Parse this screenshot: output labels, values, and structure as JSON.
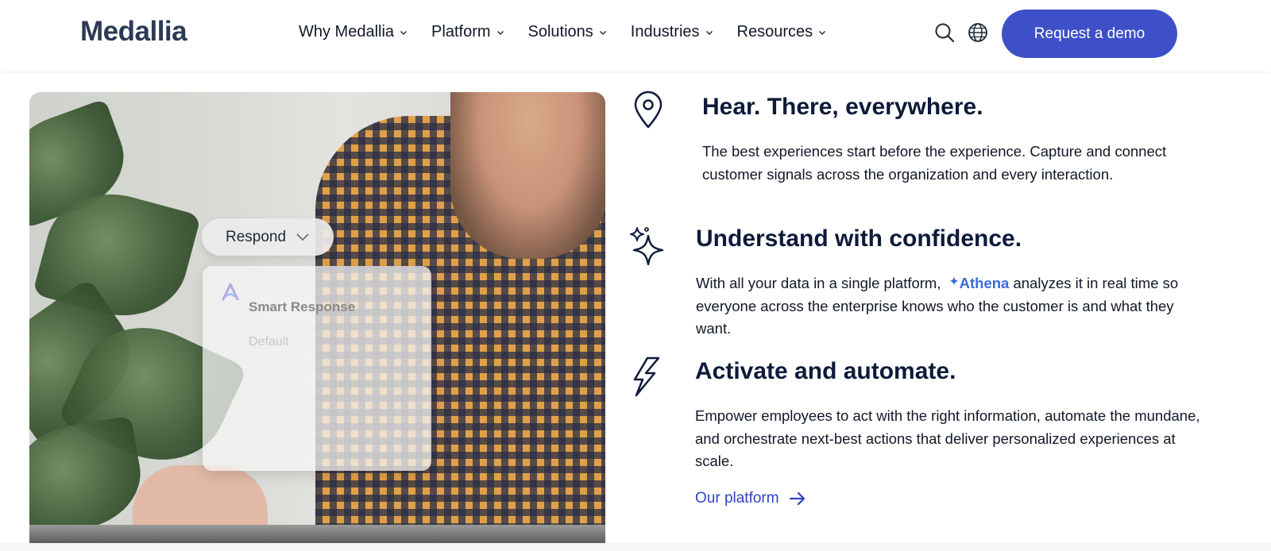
{
  "header": {
    "logo": "Medallia",
    "nav": [
      {
        "label": "Why Medallia"
      },
      {
        "label": "Platform"
      },
      {
        "label": "Solutions"
      },
      {
        "label": "Industries"
      },
      {
        "label": "Resources"
      }
    ],
    "cta": "Request a demo",
    "icons": [
      "search-icon",
      "globe-icon",
      "chevron-down-icon"
    ]
  },
  "photo": {
    "respond_label": "Respond",
    "card_title": "Smart Response",
    "card_option": "Default"
  },
  "features": [
    {
      "icon": "location-pin-icon",
      "title": "Hear. There, everywhere.",
      "text": "The best experiences start before the experience. Capture and connect customer signals across the organization and every interaction."
    },
    {
      "icon": "sparkles-icon",
      "title": "Understand with confidence.",
      "text_before": "With all your data in a single platform,",
      "highlight": "Athena",
      "text_after": "analyzes it in real time so everyone across the enterprise knows who the customer is and what they want."
    },
    {
      "icon": "lightning-icon",
      "title": "Activate and automate.",
      "text": "Empower employees to act with the right information, automate the mundane, and orchestrate next-best actions that deliver personalized experiences at scale."
    }
  ],
  "link": {
    "label": "Our platform",
    "icon": "arrow-right-icon"
  },
  "colors": {
    "accent": "#3e50c8",
    "heading": "#0d1a3a",
    "link": "#2f43c4",
    "athena": "#3b6bdc"
  }
}
